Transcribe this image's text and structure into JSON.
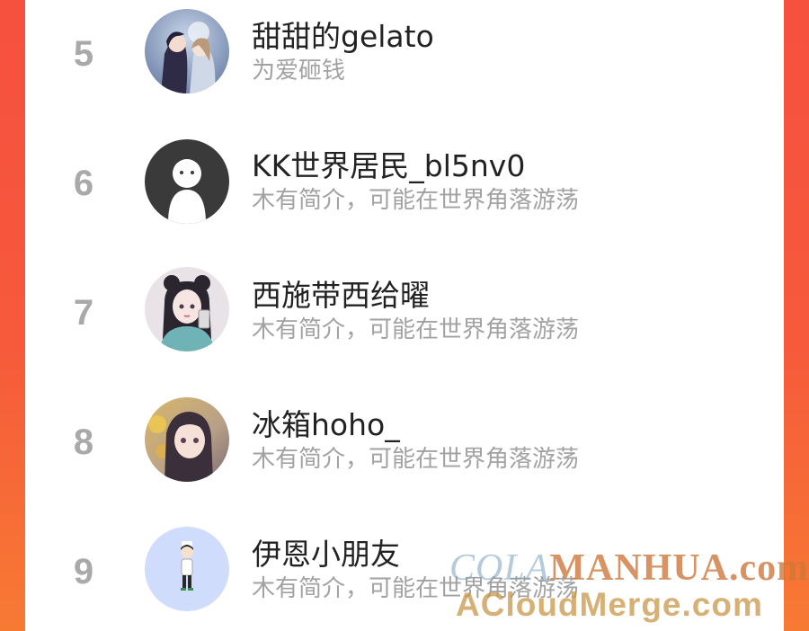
{
  "list": [
    {
      "rank": "5",
      "name": "甜甜的gelato",
      "bio": "为爱砸钱",
      "avatar_icon": "couple-illustration-avatar"
    },
    {
      "rank": "6",
      "name": "KK世界居民_bl5nv0",
      "bio": "木有简介，可能在世界角落游荡",
      "avatar_icon": "default-ghost-avatar"
    },
    {
      "rank": "7",
      "name": "西施带西给曜",
      "bio": "木有简介，可能在世界角落游荡",
      "avatar_icon": "girl-selfie-avatar"
    },
    {
      "rank": "8",
      "name": "冰箱hoho_",
      "bio": "木有简介，可能在世界角落游荡",
      "avatar_icon": "anime-girl-avatar"
    },
    {
      "rank": "9",
      "name": "伊恩小朋友",
      "bio": "木有简介，可能在世界角落游荡",
      "avatar_icon": "chibi-figure-avatar"
    }
  ],
  "watermark": {
    "line1_part1": "COLA",
    "line1_part2": "MANHUA.com",
    "line2": "ACloudMerge.com"
  },
  "colors": {
    "background_gradient_top": "#f6503f",
    "background_gradient_bottom": "#f77a33",
    "rank_number": "#a9a9a9",
    "name_text": "#222222",
    "bio_text": "#a2a2a2"
  }
}
